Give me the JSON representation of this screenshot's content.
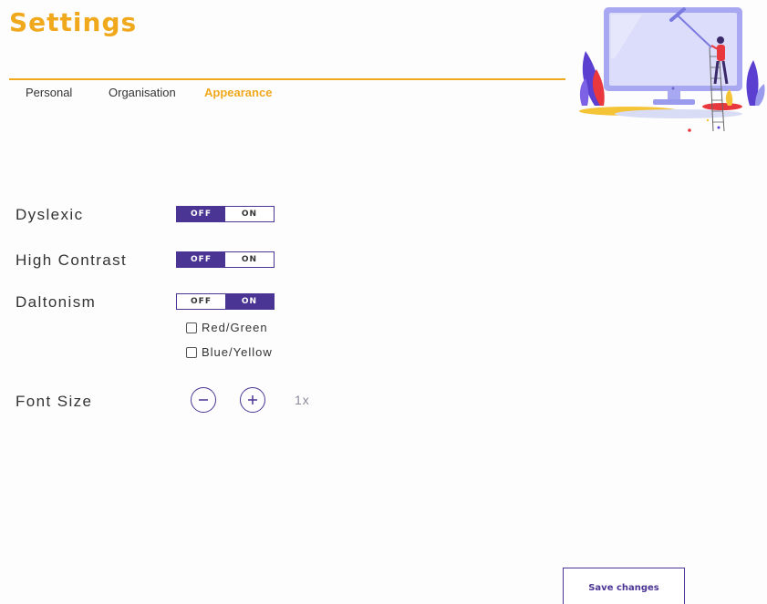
{
  "page": {
    "title": "Settings"
  },
  "tabs": [
    {
      "label": "Personal",
      "active": false
    },
    {
      "label": "Organisation",
      "active": false
    },
    {
      "label": "Appearance",
      "active": true
    }
  ],
  "settings": {
    "dyslexic": {
      "label": "Dyslexic",
      "off": "OFF",
      "on": "ON",
      "value": "OFF"
    },
    "high_contrast": {
      "label": "High Contrast",
      "off": "OFF",
      "on": "ON",
      "value": "OFF"
    },
    "daltonism": {
      "label": "Daltonism",
      "off": "OFF",
      "on": "ON",
      "value": "ON",
      "options": [
        {
          "label": "Red/Green",
          "checked": false
        },
        {
          "label": "Blue/Yellow",
          "checked": false
        }
      ]
    },
    "font_size": {
      "label": "Font Size",
      "value": "1x"
    }
  },
  "footer": {
    "save_label": "Save changes"
  },
  "colors": {
    "accent": "#f0a81c",
    "primary": "#4b3594"
  }
}
